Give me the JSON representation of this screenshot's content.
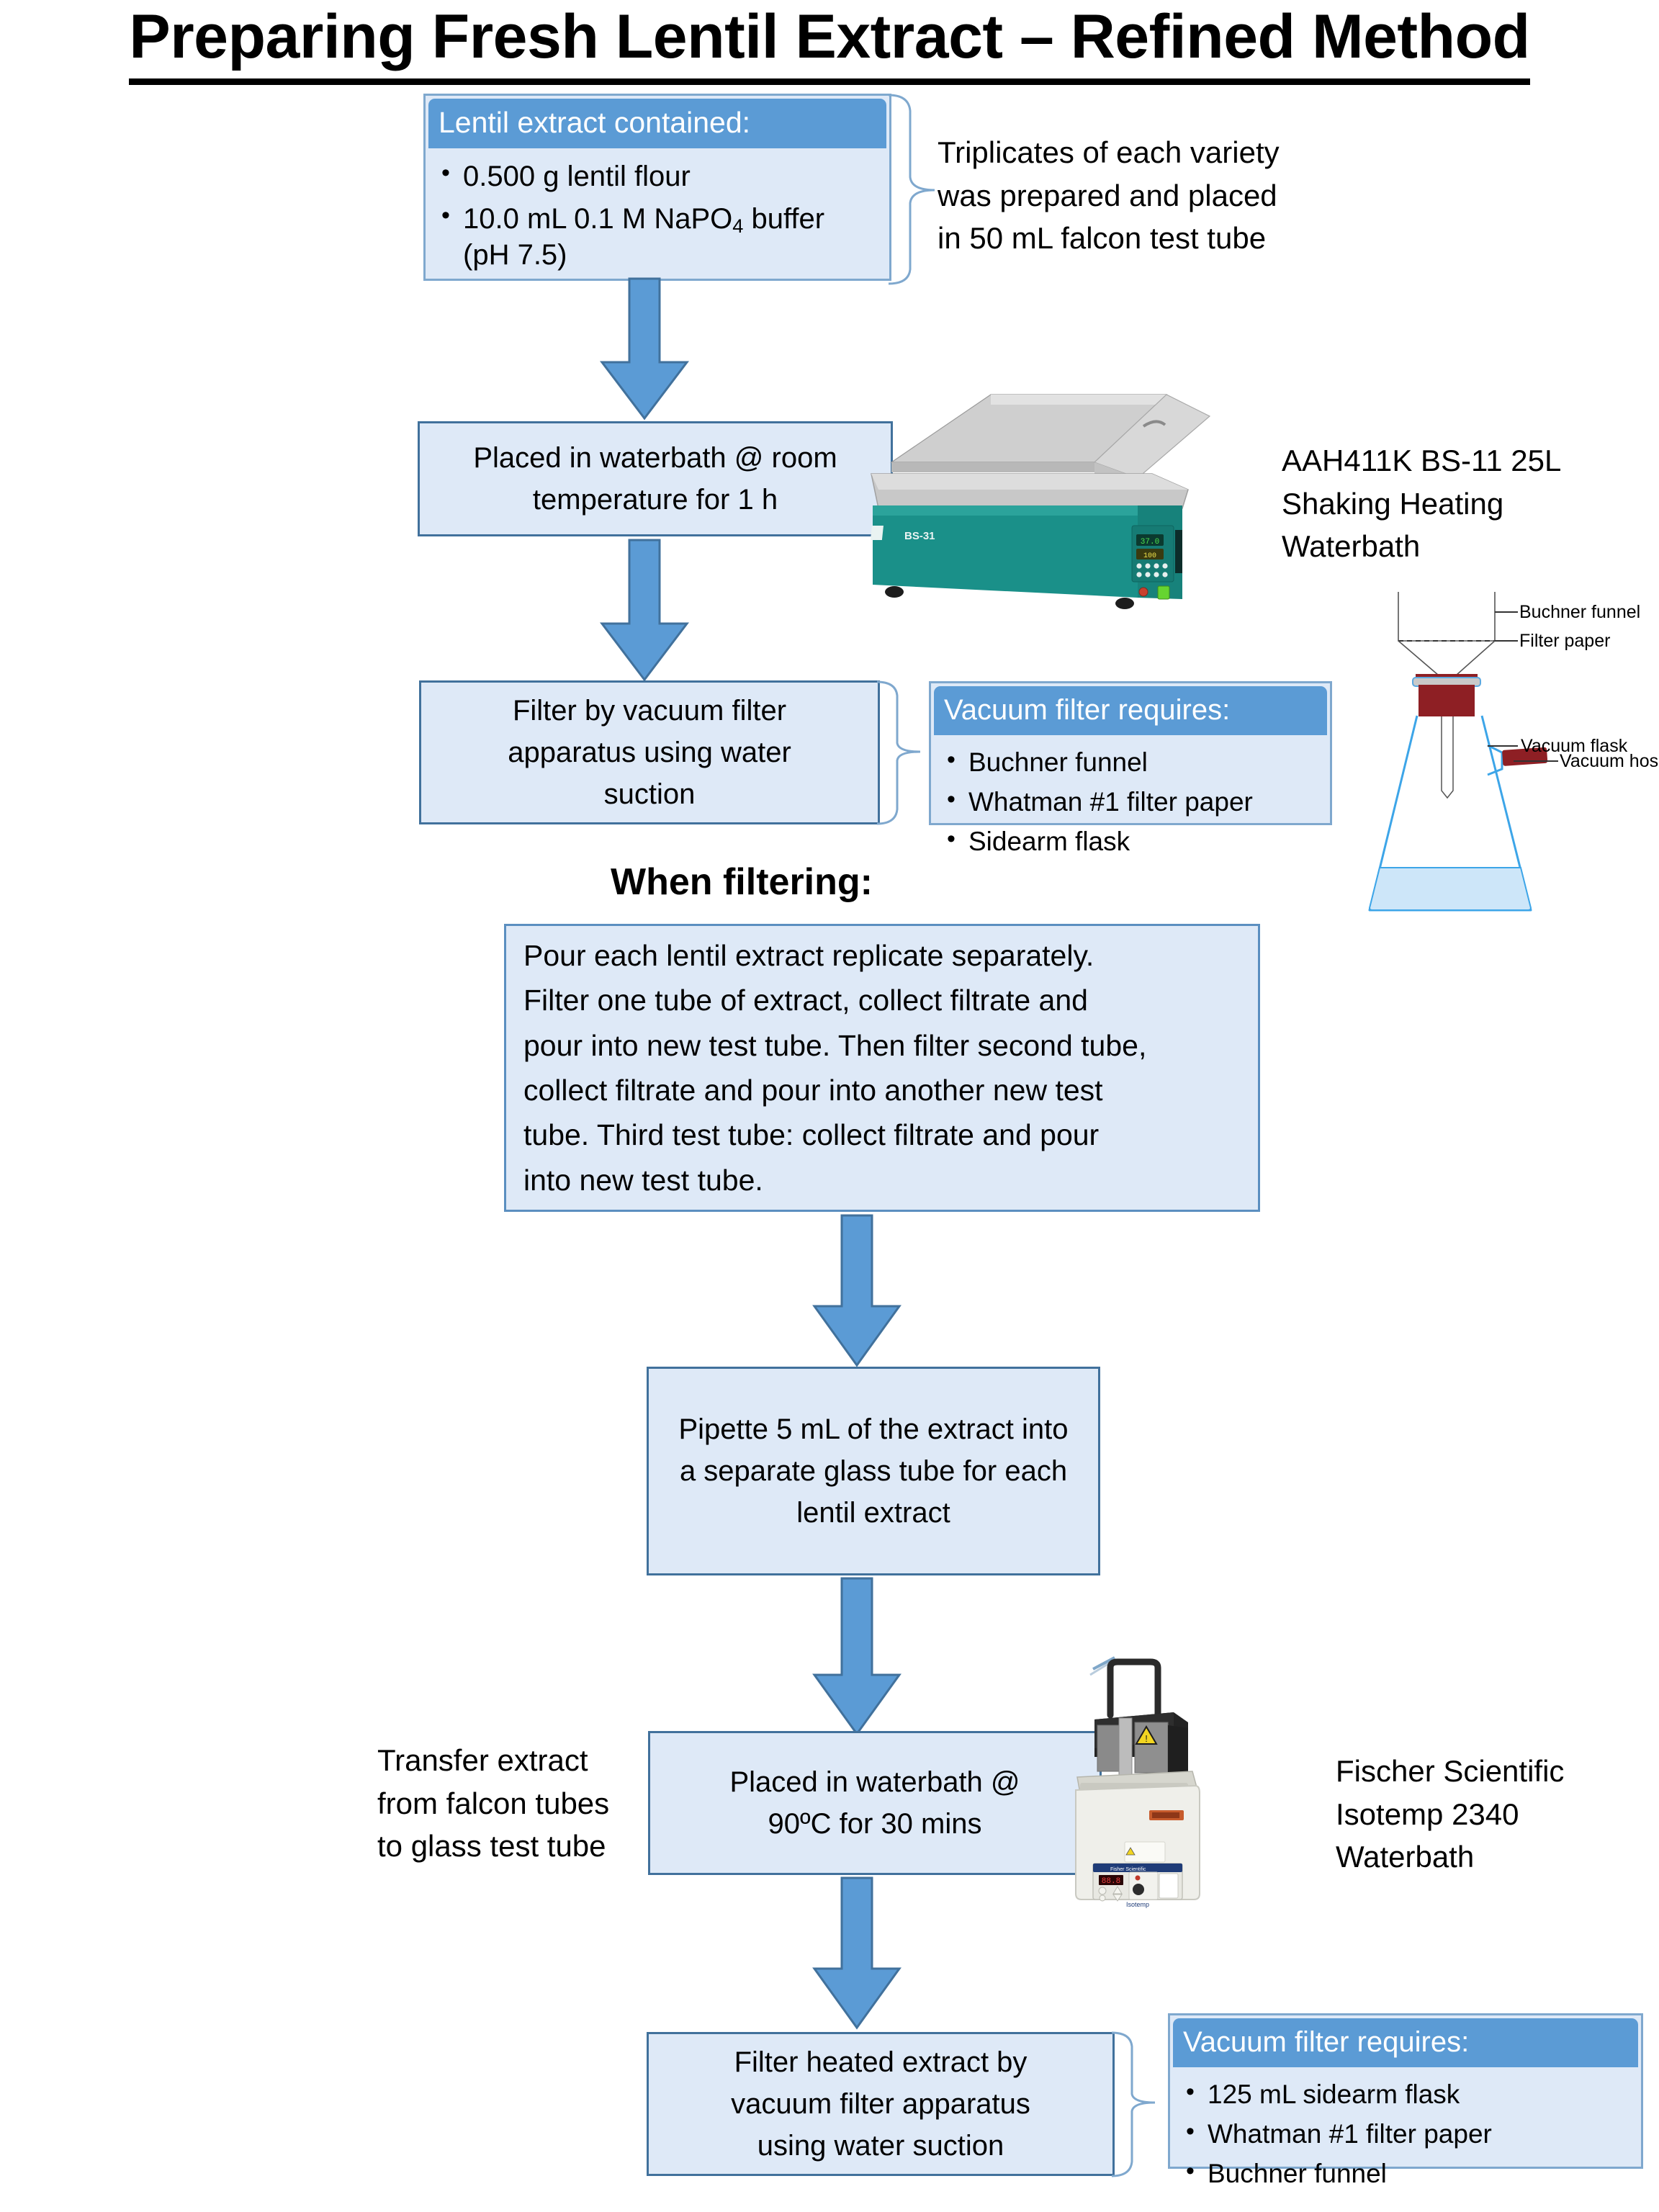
{
  "title": "Preparing Fresh Lentil Extract – Refined Method",
  "section_heading": "When filtering:",
  "callout_ingredients": {
    "header": "Lentil extract contained:",
    "items": [
      "0.500 g lentil flour",
      "10.0 mL 0.1 M NaPO4 buffer (pH 7.5)"
    ],
    "item_1_pre": "10.0 mL 0.1 M NaPO",
    "item_1_sub": "4",
    "item_1_post": " buffer",
    "item_1_line2": "(pH 7.5)"
  },
  "note_triplicates": "Triplicates of each variety was prepared and placed in 50 mL falcon test tube",
  "note_triplicates_lines": [
    "Triplicates of each variety",
    "was prepared and placed",
    "in 50 mL falcon test tube"
  ],
  "step_waterbath_rt": {
    "line1": "Placed in waterbath @ room",
    "line2": "temperature for 1 h"
  },
  "equipment_shaking_waterbath": {
    "lines": [
      "AAH411K BS-11 25L",
      "Shaking Heating",
      "Waterbath"
    ],
    "panel_display_top": "37.0",
    "panel_display_bottom": "100",
    "body_label": "BS-31"
  },
  "step_filter_vacuum": {
    "line1": "Filter by vacuum filter",
    "line2": "apparatus using water",
    "line3": "suction"
  },
  "callout_vacuum_1": {
    "header": "Vacuum filter requires:",
    "items": [
      "Buchner funnel",
      "Whatman #1 filter paper",
      "Sidearm flask"
    ]
  },
  "apparatus_diagram": {
    "labels": [
      "Buchner funnel",
      "Filter paper",
      "Vacuum flask",
      "Vacuum hose"
    ]
  },
  "step_pour_detail": {
    "lines": [
      "Pour each lentil extract replicate separately.",
      "Filter one tube of extract, collect filtrate and",
      "pour into new test tube. Then filter second tube,",
      "collect filtrate and pour into another new test",
      "tube. Third test tube: collect filtrate and pour",
      "into new test tube."
    ]
  },
  "step_pipette": {
    "line1": "Pipette 5 mL of the extract into",
    "line2": "a separate glass tube for each",
    "line3": "lentil extract"
  },
  "note_transfer": {
    "lines": [
      "Transfer extract",
      "from falcon tubes",
      "to glass test tube"
    ]
  },
  "step_waterbath_90": {
    "line1": "Placed in waterbath @",
    "line2": "90ºC for 30 mins"
  },
  "equipment_isotemp_waterbath": {
    "lines": [
      "Fischer Scientific",
      "Isotemp 2340",
      "Waterbath"
    ],
    "brand_label": "Fisher Scientific",
    "model_label": "Isotemp"
  },
  "step_filter_heated": {
    "line1": "Filter heated extract by",
    "line2": "vacuum filter apparatus",
    "line3": "using water suction"
  },
  "callout_vacuum_2": {
    "header": "Vacuum filter requires:",
    "items": [
      "125 mL sidearm flask",
      "Whatman #1 filter paper",
      "Buchner funnel"
    ]
  },
  "colors": {
    "box_fill": "#DEE9F7",
    "box_border": "#41719C",
    "accent": "#5B9BD5",
    "arrow_fill": "#5B9BD5",
    "arrow_border": "#41719C",
    "header_text": "#FFFFFF",
    "equip_teal": "#1A9089",
    "flask_blue": "#3DA5E8",
    "stopper_red": "#8E1F24"
  }
}
